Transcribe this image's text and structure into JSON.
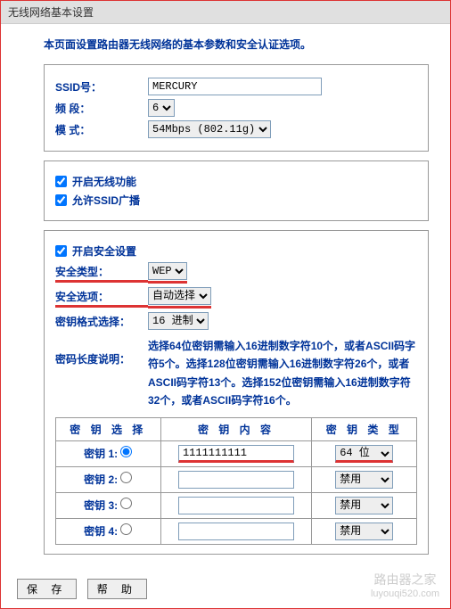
{
  "header": {
    "title": "无线网络基本设置"
  },
  "intro": "本页面设置路由器无线网络的基本参数和安全认证选项。",
  "basic": {
    "ssid_label": "SSID号：",
    "ssid_value": "MERCURY",
    "band_label": "频 段：",
    "band_value": "6",
    "mode_label": "模 式：",
    "mode_value": "54Mbps (802.11g)"
  },
  "wireless": {
    "enable_wifi": "开启无线功能",
    "enable_broadcast": "允许SSID广播"
  },
  "security": {
    "enable_label": "开启安全设置",
    "type_label": "安全类型：",
    "type_value": "WEP",
    "option_label": "安全选项：",
    "option_value": "自动选择",
    "format_label": "密钥格式选择：",
    "format_value": "16 进制",
    "length_label": "密码长度说明：",
    "length_desc": "选择64位密钥需输入16进制数字符10个，或者ASCII码字符5个。选择128位密钥需输入16进制数字符26个，或者ASCII码字符13个。选择152位密钥需输入16进制数字符32个，或者ASCII码字符16个。"
  },
  "key_table": {
    "col_select": "密 钥 选 择",
    "col_content": "密 钥 内 容",
    "col_type": "密 钥 类 型",
    "rows": [
      {
        "label": "密钥 1:",
        "value": "1111111111",
        "type": "64 位",
        "checked": true
      },
      {
        "label": "密钥 2:",
        "value": "",
        "type": "禁用",
        "checked": false
      },
      {
        "label": "密钥 3:",
        "value": "",
        "type": "禁用",
        "checked": false
      },
      {
        "label": "密钥 4:",
        "value": "",
        "type": "禁用",
        "checked": false
      }
    ]
  },
  "footer": {
    "save": "保 存",
    "help": "帮 助"
  },
  "watermark": {
    "line1": "路由器之家",
    "line2": "luyouqi520.com"
  }
}
